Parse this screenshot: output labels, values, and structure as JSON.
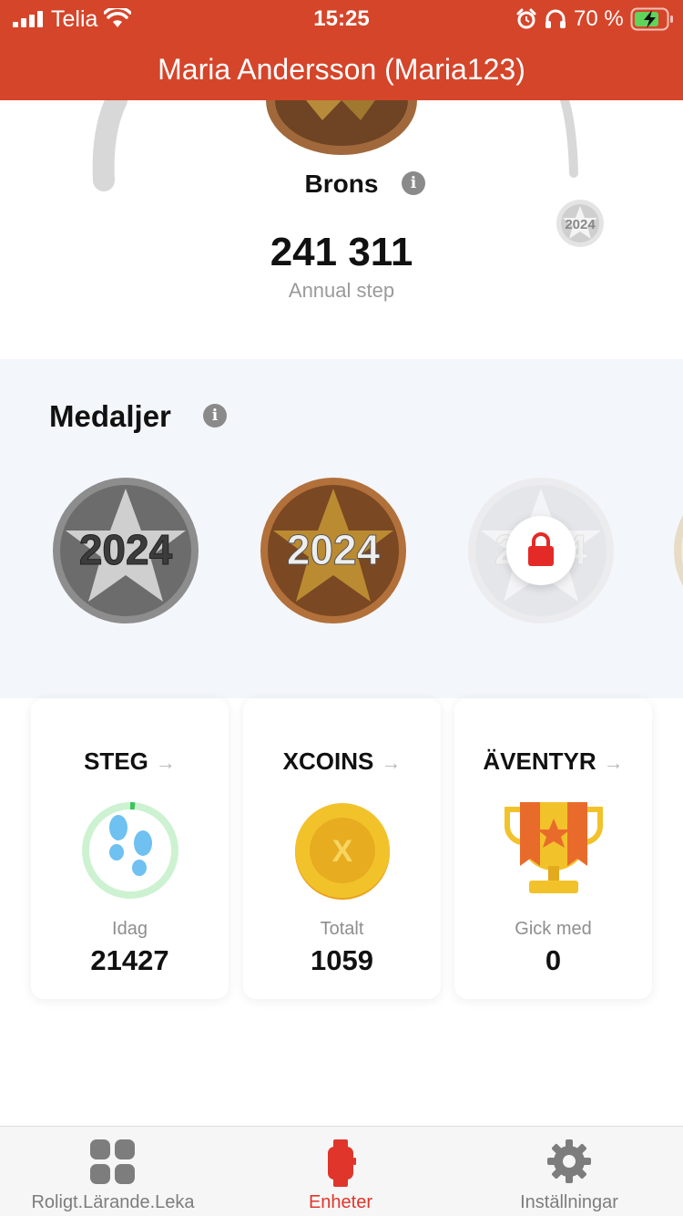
{
  "status_bar": {
    "carrier": "Telia",
    "time": "15:25",
    "battery_percent": "70 %"
  },
  "header": {
    "title": "Maria Andersson (Maria123)"
  },
  "level": {
    "name": "Brons",
    "total_steps": "241 311",
    "steps_label": "Annual step",
    "next_medal_year": "2024"
  },
  "medals": {
    "title": "Medaljer",
    "items": [
      {
        "year": "2024",
        "tier": "silver",
        "locked": false
      },
      {
        "year": "2024",
        "tier": "bronze",
        "locked": false
      },
      {
        "year": "2024",
        "tier": "locked",
        "locked": true
      }
    ]
  },
  "cards": [
    {
      "title": "STEG",
      "label": "Idag",
      "value": "21427",
      "icon": "footsteps-icon"
    },
    {
      "title": "XCOINS",
      "label": "Totalt",
      "value": "1059",
      "icon": "xcoin-icon"
    },
    {
      "title": "ÄVENTYR",
      "label": "Gick med",
      "value": "0",
      "icon": "trophy-icon"
    }
  ],
  "tabbar": {
    "items": [
      {
        "label": "Roligt.Lärande.Leka",
        "icon": "grid-icon",
        "active": false
      },
      {
        "label": "Enheter",
        "icon": "watch-icon",
        "active": true
      },
      {
        "label": "Inställningar",
        "icon": "gear-icon",
        "active": false
      }
    ]
  },
  "colors": {
    "brand": "#d5452a",
    "active_tab": "#e0352b",
    "inactive_tab": "#7d7d7d",
    "bronze": "#a86a3c",
    "silver": "#9a9a9a"
  }
}
